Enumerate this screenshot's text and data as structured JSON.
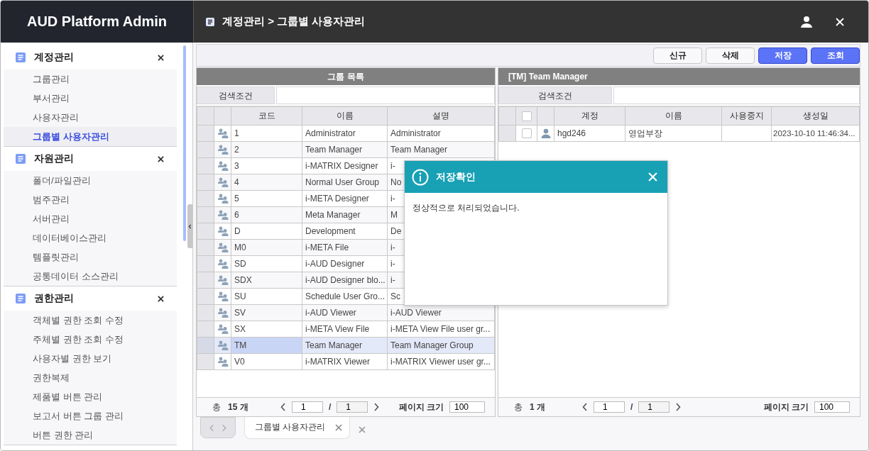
{
  "app_title": "AUD Platform Admin",
  "breadcrumb": "계정관리 > 그룹별 사용자관리",
  "sidebar": {
    "sections": [
      {
        "title": "계정관리",
        "items": [
          {
            "label": "그룹관리",
            "selected": false
          },
          {
            "label": "부서관리",
            "selected": false
          },
          {
            "label": "사용자관리",
            "selected": false
          },
          {
            "label": "그룹별 사용자관리",
            "selected": true
          }
        ]
      },
      {
        "title": "자원관리",
        "items": [
          {
            "label": "폴더/파일관리",
            "selected": false
          },
          {
            "label": "범주관리",
            "selected": false
          },
          {
            "label": "서버관리",
            "selected": false
          },
          {
            "label": "데이터베이스관리",
            "selected": false
          },
          {
            "label": "템플릿관리",
            "selected": false
          },
          {
            "label": "공통데이터 소스관리",
            "selected": false
          }
        ]
      },
      {
        "title": "권한관리",
        "items": [
          {
            "label": "객체별 권한 조회 수정",
            "selected": false
          },
          {
            "label": "주체별 권한 조회 수정",
            "selected": false
          },
          {
            "label": "사용자별 권한 보기",
            "selected": false
          },
          {
            "label": "권한복제",
            "selected": false
          },
          {
            "label": "제품별 버튼 관리",
            "selected": false
          },
          {
            "label": "보고서 버튼 그룹 관리",
            "selected": false
          },
          {
            "label": "버튼 권한 관리",
            "selected": false
          }
        ]
      }
    ]
  },
  "toolbar": {
    "buttons": [
      {
        "label": "신규",
        "kind": "default"
      },
      {
        "label": "삭제",
        "kind": "default"
      },
      {
        "label": "저장",
        "kind": "primary"
      },
      {
        "label": "조회",
        "kind": "primary"
      }
    ]
  },
  "group_panel": {
    "title": "그룹 목록",
    "search_label": "검색조건",
    "columns": [
      "코드",
      "이름",
      "설명"
    ],
    "rows": [
      {
        "code": "1",
        "name": "Administrator",
        "description": "Administrator",
        "selected": false
      },
      {
        "code": "2",
        "name": "Team Manager",
        "description": "Team Manager",
        "selected": false
      },
      {
        "code": "3",
        "name": "i-MATRIX Designer",
        "description": "i-",
        "selected": false
      },
      {
        "code": "4",
        "name": "Normal User Group",
        "description": "No",
        "selected": false
      },
      {
        "code": "5",
        "name": "i-META Designer",
        "description": "i-",
        "selected": false
      },
      {
        "code": "6",
        "name": "Meta Manager",
        "description": "M",
        "selected": false
      },
      {
        "code": "D",
        "name": "Development",
        "description": "De",
        "selected": false
      },
      {
        "code": "M0",
        "name": "i-META File",
        "description": "i-",
        "selected": false
      },
      {
        "code": "SD",
        "name": "i-AUD Designer",
        "description": "i-",
        "selected": false
      },
      {
        "code": "SDX",
        "name": "i-AUD Designer blo...",
        "description": "i-",
        "selected": false
      },
      {
        "code": "SU",
        "name": "Schedule User Gro...",
        "description": "Sc",
        "selected": false
      },
      {
        "code": "SV",
        "name": "i-AUD Viewer",
        "description": "i-AUD Viewer",
        "selected": false
      },
      {
        "code": "SX",
        "name": "i-META View File",
        "description": "i-META View File user gr...",
        "selected": false
      },
      {
        "code": "TM",
        "name": "Team Manager",
        "description": "Team Manager Group",
        "selected": true
      },
      {
        "code": "V0",
        "name": "i-MATRIX Viewer",
        "description": "i-MATRIX Viewer user gr...",
        "selected": false
      }
    ],
    "footer": {
      "total_label": "총",
      "total": "15",
      "unit": "개",
      "page": "1",
      "separator": "/",
      "pages": "1",
      "page_size_label": "페이지 크기",
      "page_size": "100"
    }
  },
  "member_panel": {
    "title": "[TM] Team Manager",
    "search_label": "검색조건",
    "header_checked": false,
    "columns": [
      "계정",
      "이름",
      "사용중지",
      "생성일"
    ],
    "rows": [
      {
        "account": "hgd246",
        "name": "영업부장",
        "created": "2023-10-10 11:46:34...",
        "checked": false
      }
    ],
    "footer": {
      "total_label": "총",
      "total": "1",
      "unit": "개",
      "page": "1",
      "separator": "/",
      "pages": "1",
      "page_size_label": "페이지 크기",
      "page_size": "100"
    }
  },
  "tabs": [
    {
      "label": "그룹별 사용자관리",
      "selected": true
    }
  ],
  "dialog": {
    "title": "저장확인",
    "message": "정상적으로 처리되었습니다."
  }
}
